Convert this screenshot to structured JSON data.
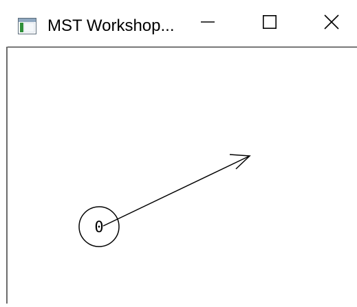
{
  "window": {
    "title": "MST Workshop...",
    "controls": {
      "minimize": "minimize-icon",
      "maximize": "maximize-icon",
      "close": "close-icon"
    },
    "app_icon": "app-window-icon"
  },
  "canvas": {
    "nodes": [
      {
        "label": "0"
      }
    ],
    "edges": [
      {
        "from": "0",
        "directed": true
      }
    ],
    "colors": {
      "stroke": "#000000",
      "background": "#ffffff"
    }
  }
}
